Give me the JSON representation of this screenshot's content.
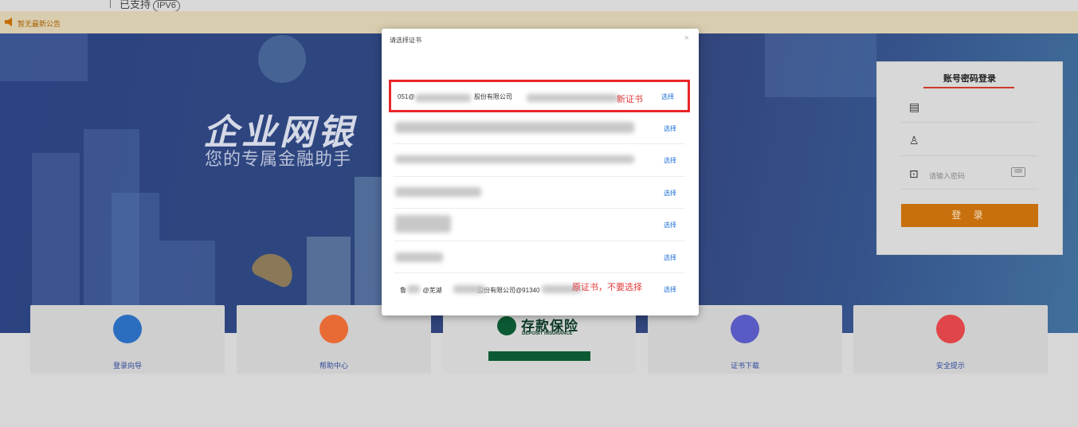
{
  "topbar": {
    "support_text": "已支持",
    "ipv6_badge": "IPV6"
  },
  "notice": {
    "text": "暂无最新公告"
  },
  "banner": {
    "title": "企业网银",
    "subtitle": "您的专属金融助手"
  },
  "login": {
    "title": "账号密码登录",
    "password_placeholder": "请输入密码",
    "login_button": "登 录"
  },
  "features": [
    {
      "label": "登录向导",
      "icon": "user-icon",
      "color": "#2b6ec0"
    },
    {
      "label": "帮助中心",
      "icon": "book-icon",
      "color": "#e86b36"
    },
    {
      "label": "证书下载",
      "icon": "download-icon",
      "color": "#5a5ac4"
    },
    {
      "label": "安全提示",
      "icon": "bulb-icon",
      "color": "#e0454a"
    }
  ],
  "deposit": {
    "title": "存款保险",
    "subtitle": "DEPOSIT INSURANCE"
  },
  "modal": {
    "title": "请选择证书",
    "close": "×",
    "items": [
      {
        "name_start": "051@",
        "name_mid": "股份有限公司",
        "note": "新证书",
        "action": "选择"
      },
      {
        "action": "选择"
      },
      {
        "action": "选择"
      },
      {
        "action": "选择"
      },
      {
        "action": "选择"
      },
      {
        "action": "选择"
      },
      {
        "name_start": "鲁",
        "name_mid": "@芜湖",
        "name_end": "股份有限公司@91340",
        "note": "原证书，不要选择",
        "action": "选择"
      }
    ]
  },
  "colors": {
    "highlight_border": "#e8262a",
    "link": "#1d6fd6",
    "login_button": "#c8700e",
    "note": "#e23c3c"
  }
}
